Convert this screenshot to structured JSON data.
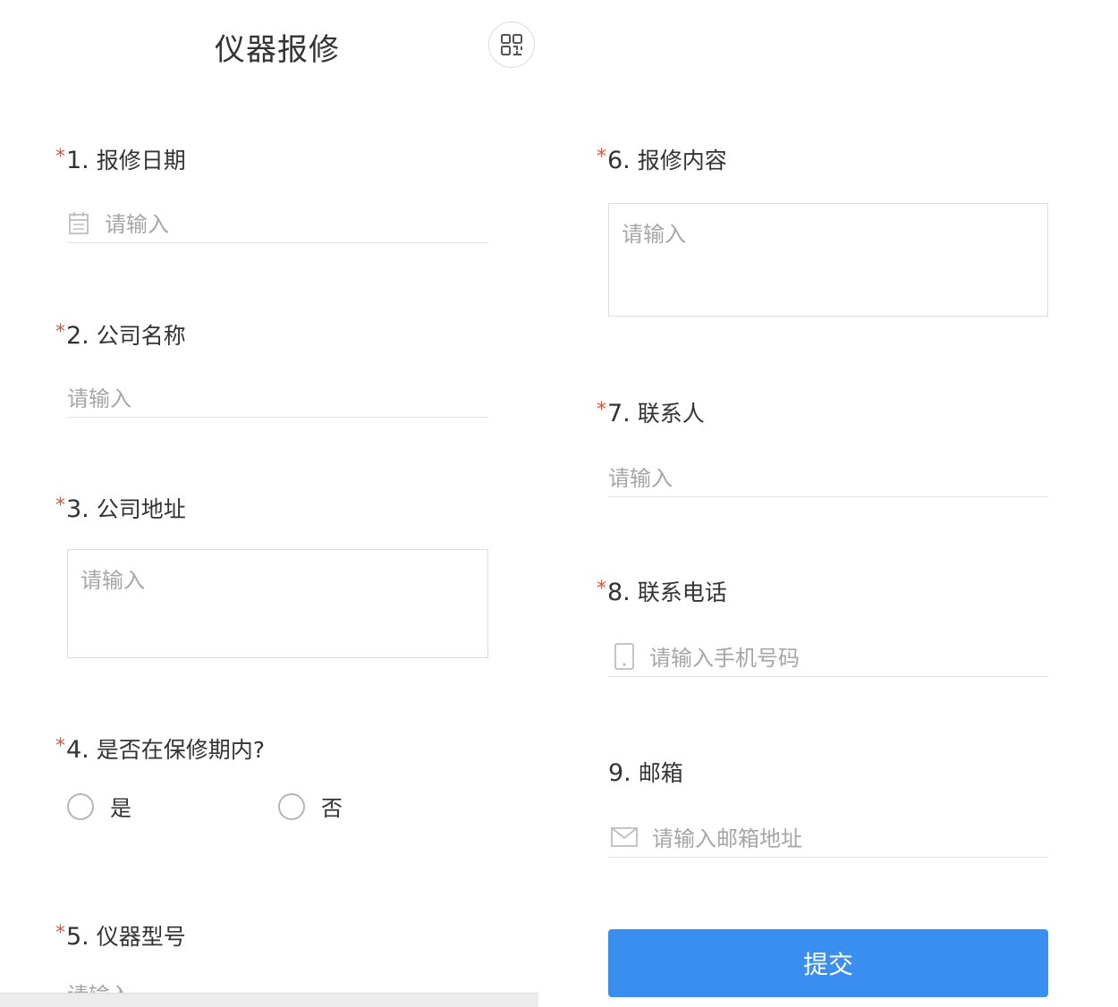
{
  "header": {
    "title": "仪器报修",
    "qr_icon": "qrcode-icon"
  },
  "required_mark": "*",
  "questions": [
    {
      "num": "1.",
      "label": "报修日期",
      "required": true,
      "placeholder": "请输入",
      "icon": "calendar-icon"
    },
    {
      "num": "2.",
      "label": "公司名称",
      "required": true,
      "placeholder": "请输入"
    },
    {
      "num": "3.",
      "label": "公司地址",
      "required": true,
      "placeholder": "请输入"
    },
    {
      "num": "4.",
      "label": "是否在保修期内?",
      "required": true,
      "options": [
        "是",
        "否"
      ]
    },
    {
      "num": "5.",
      "label": "仪器型号",
      "required": true,
      "placeholder": "请输入"
    },
    {
      "num": "6.",
      "label": "报修内容",
      "required": true,
      "placeholder": "请输入"
    },
    {
      "num": "7.",
      "label": "联系人",
      "required": true,
      "placeholder": "请输入"
    },
    {
      "num": "8.",
      "label": "联系电话",
      "required": true,
      "placeholder": "请输入手机号码",
      "icon": "mobile-phone-icon"
    },
    {
      "num": "9.",
      "label": "邮箱",
      "required": false,
      "placeholder": "请输入邮箱地址",
      "icon": "mail-icon"
    }
  ],
  "submit_label": "提交",
  "colors": {
    "accent": "#3a8ef0",
    "required": "#e2533a",
    "placeholder": "#a6a6a6",
    "border": "#dcdcdc"
  }
}
